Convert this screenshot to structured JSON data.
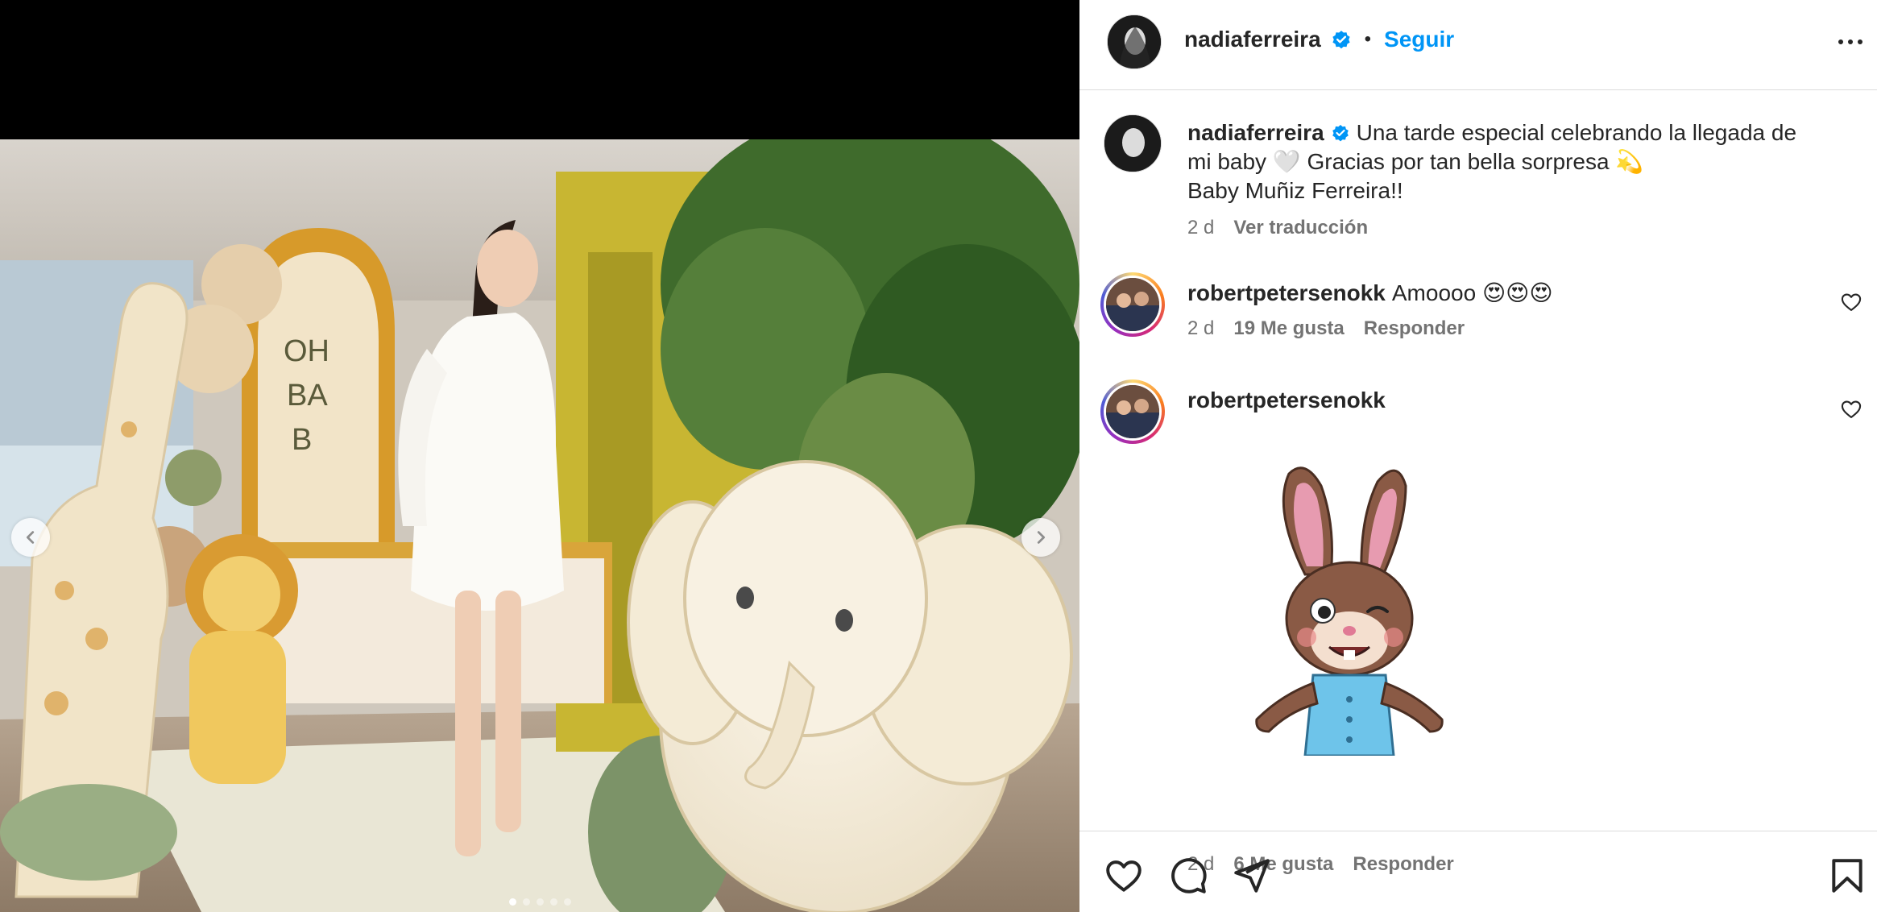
{
  "post": {
    "author": "nadiaferreira",
    "follow_label": "Seguir",
    "separator": "•",
    "caption_line1": "Una tarde especial celebrando la llegada de",
    "caption_line2": "mi baby 🤍 Gracias por tan bella sorpresa 💫",
    "caption_line3": "Baby Muñiz Ferreira!!",
    "caption_time": "2 d",
    "translate_label": "Ver traducción"
  },
  "comments": [
    {
      "username": "robertpetersenokk",
      "text": "Amoooo 😍😍😍",
      "time": "2 d",
      "likes": "19 Me gusta",
      "reply_label": "Responder"
    },
    {
      "username": "robertpetersenokk",
      "text": "",
      "time": "2 d",
      "likes": "6 Me gusta",
      "reply_label": "Responder"
    }
  ],
  "photo_sign": [
    "OH",
    "BA",
    "B"
  ],
  "carousel": {
    "slides": 5,
    "active": 1
  },
  "colors": {
    "accent": "#0095f6",
    "verified": "#0095f6",
    "text": "#262626",
    "muted": "#737373"
  },
  "icons": [
    "verified-icon",
    "more-icon",
    "heart-icon",
    "comment-icon",
    "share-icon",
    "bookmark-icon",
    "chevron-left-icon",
    "chevron-right-icon"
  ]
}
